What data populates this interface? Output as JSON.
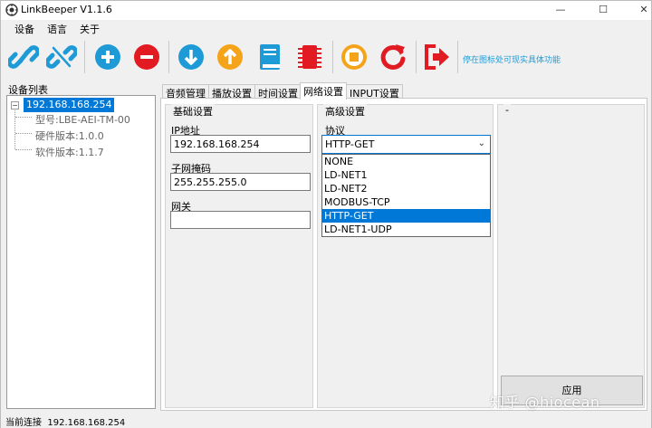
{
  "window": {
    "title": "LinkBeeper V1.1.6",
    "minimize_glyph": "—",
    "maximize_glyph": "☐",
    "close_glyph": "✕"
  },
  "menu": {
    "items": [
      "设备",
      "语言",
      "关于"
    ]
  },
  "toolbar": {
    "buttons": [
      "link-icon",
      "unlink-icon",
      "add-icon",
      "remove-icon",
      "download-icon",
      "upload-icon",
      "book-icon",
      "chip-icon",
      "stop-icon",
      "refresh-icon",
      "exit-icon"
    ],
    "hint": "停在图标处可现实具体功能",
    "colors": {
      "blue": "#1e9bd7",
      "red": "#e21b22",
      "orange": "#f5a319"
    }
  },
  "device_panel": {
    "title": "设备列表",
    "root": "192.168.168.254",
    "toggle_glyph": "−",
    "children": [
      "型号:LBE-AEI-TM-00",
      "硬件版本:1.0.0",
      "软件版本:1.1.7"
    ]
  },
  "tabs": [
    "音频管理",
    "播放设置",
    "时间设置",
    "网络设置",
    "INPUT设置"
  ],
  "active_tab": "网络设置",
  "basic": {
    "title": "基础设置",
    "ip_label": "IP地址",
    "ip_value": "192.168.168.254",
    "mask_label": "子网掩码",
    "mask_value": "255.255.255.0",
    "gateway_label": "网关",
    "gateway_value": ""
  },
  "advanced": {
    "title": "高级设置",
    "protocol_label": "协议",
    "protocol_value": "HTTP-GET",
    "arrow_glyph": "⌄",
    "options": [
      "NONE",
      "LD-NET1",
      "LD-NET2",
      "MODBUS-TCP",
      "HTTP-GET",
      "LD-NET1-UDP"
    ]
  },
  "right_group": {
    "title": "-"
  },
  "apply_label": "应用",
  "status": {
    "label": "当前连接",
    "value": "192.168.168.254"
  },
  "watermark": "知乎 @hiocean"
}
